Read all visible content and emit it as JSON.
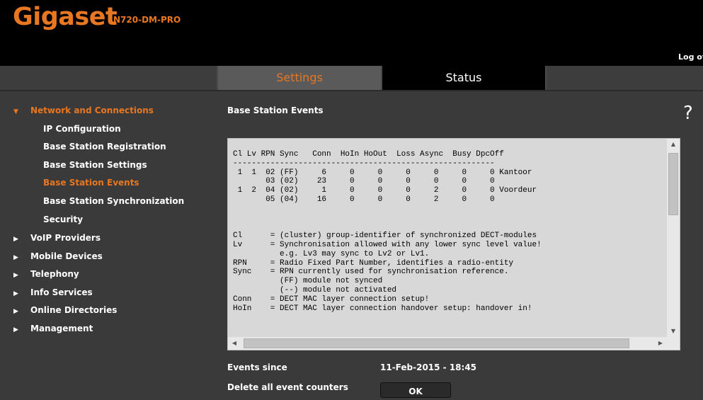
{
  "header": {
    "brand": "Gigaset",
    "model": "N720-DM-PRO",
    "logoff": "Log off"
  },
  "tabs": [
    {
      "label": "Settings",
      "active": true
    },
    {
      "label": "Status",
      "active": false
    }
  ],
  "sidebar": {
    "items": [
      {
        "label": "Network and Connections",
        "level": 0,
        "expanded": true,
        "active": true
      },
      {
        "label": "IP Configuration",
        "level": 1
      },
      {
        "label": "Base Station Registration",
        "level": 1
      },
      {
        "label": "Base Station Settings",
        "level": 1
      },
      {
        "label": "Base Station Events",
        "level": 1,
        "active": true
      },
      {
        "label": "Base Station Synchronization",
        "level": 1
      },
      {
        "label": "Security",
        "level": 1
      },
      {
        "label": "VoIP Providers",
        "level": 0
      },
      {
        "label": "Mobile Devices",
        "level": 0
      },
      {
        "label": "Telephony",
        "level": 0
      },
      {
        "label": "Info Services",
        "level": 0
      },
      {
        "label": "Online Directories",
        "level": 0
      },
      {
        "label": "Management",
        "level": 0
      }
    ]
  },
  "main": {
    "title": "Base Station Events",
    "help": "?",
    "events_text": "Cl Lv RPN Sync   Conn  HoIn HoOut  Loss Async  Busy DpcOff\n--------------------------------------------------------\n 1  1  02 (FF)     6     0     0     0     0     0     0 Kantoor\n       03 (02)    23     0     0     0     0     0     0\n 1  2  04 (02)     1     0     0     0     2     0     0 Voordeur\n       05 (04)    16     0     0     0     2     0     0\n\n\n\nCl      = (cluster) group-identifier of synchronized DECT-modules\nLv      = Synchronisation allowed with any lower sync level value!\n          e.g. Lv3 may sync to Lv2 or Lv1.\nRPN     = Radio Fixed Part Number, identifies a radio-entity\nSync    = RPN currently used for synchronisation reference.\n          (FF) module not synced\n          (--) module not activated\nConn    = DECT MAC layer connection setup!\nHoIn    = DECT MAC layer connection handover setup: handover in!",
    "events_since_label": "Events since",
    "events_since_value": "11-Feb-2015 - 18:45",
    "delete_label": "Delete all event counters",
    "ok_label": "OK"
  },
  "colors": {
    "accent": "#e87722",
    "background": "#3a3a3a",
    "header": "#000000"
  }
}
